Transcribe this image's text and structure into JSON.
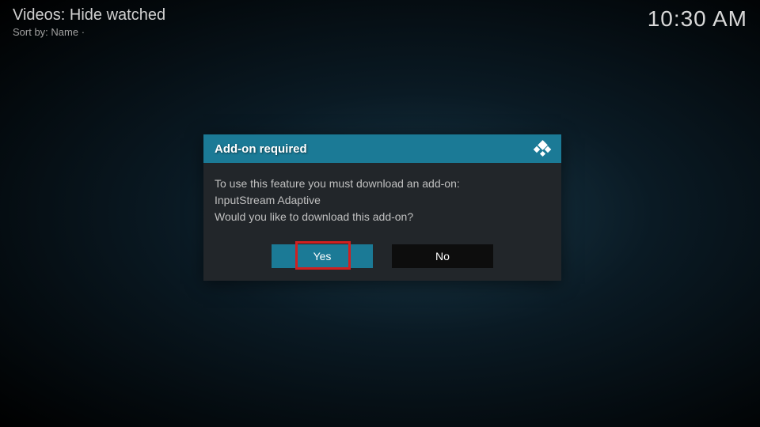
{
  "header": {
    "title": "Videos: Hide watched",
    "sort_label": "Sort by: Name  ·",
    "clock": "10:30 AM"
  },
  "dialog": {
    "title": "Add-on required",
    "line1": "To use this feature you must download an add-on:",
    "line2": "InputStream Adaptive",
    "line3": "Would you like to download this add-on?",
    "yes_label": "Yes",
    "no_label": "No"
  }
}
